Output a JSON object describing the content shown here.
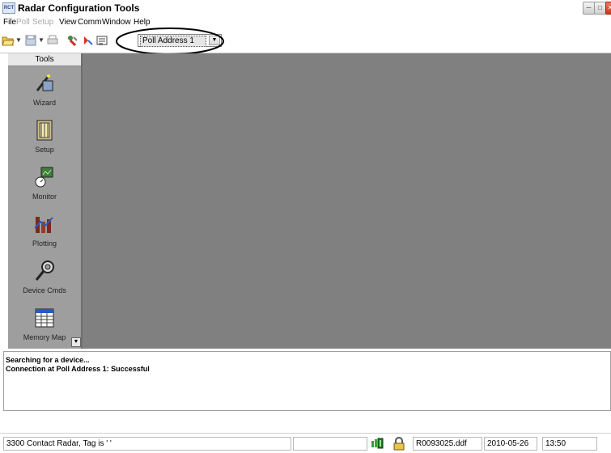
{
  "window": {
    "title": "Radar Configuration Tools",
    "app_icon_text": "RCT"
  },
  "menu": {
    "items": [
      {
        "label": "File",
        "enabled": true
      },
      {
        "label": "Poll",
        "enabled": false
      },
      {
        "label": "Setup",
        "enabled": false
      },
      {
        "label": "View",
        "enabled": true
      },
      {
        "label": "Comm",
        "enabled": true
      },
      {
        "label": "Window",
        "enabled": true
      },
      {
        "label": "Help",
        "enabled": true
      }
    ]
  },
  "toolbar": {
    "icons": [
      "open-folder-icon",
      "save-icon",
      "print-icon",
      "connect-icon",
      "disconnect-icon",
      "poll-address-icon"
    ],
    "poll_address_value": "Poll Address 1"
  },
  "tools": {
    "header": "Tools",
    "items": [
      {
        "label": "Wizard",
        "icon": "wizard-icon"
      },
      {
        "label": "Setup",
        "icon": "setup-icon"
      },
      {
        "label": "Monitor",
        "icon": "monitor-icon"
      },
      {
        "label": "Plotting",
        "icon": "plotting-icon"
      },
      {
        "label": "Device Cmds",
        "icon": "device-commands-icon"
      },
      {
        "label": "Memory Map",
        "icon": "memory-map-icon"
      }
    ]
  },
  "log": {
    "lines": [
      "Searching for a device...",
      "Connection at Poll Address 1: Successful"
    ]
  },
  "status": {
    "device": "3300 Contact Radar,  Tag is '     '",
    "file": "R0093025.ddf",
    "date": "2010-05-26",
    "time": "13:50"
  },
  "colors": {
    "workspace": "#808080",
    "tools_panel": "#9e9e9e",
    "highlight_ellipse": "#000000"
  }
}
